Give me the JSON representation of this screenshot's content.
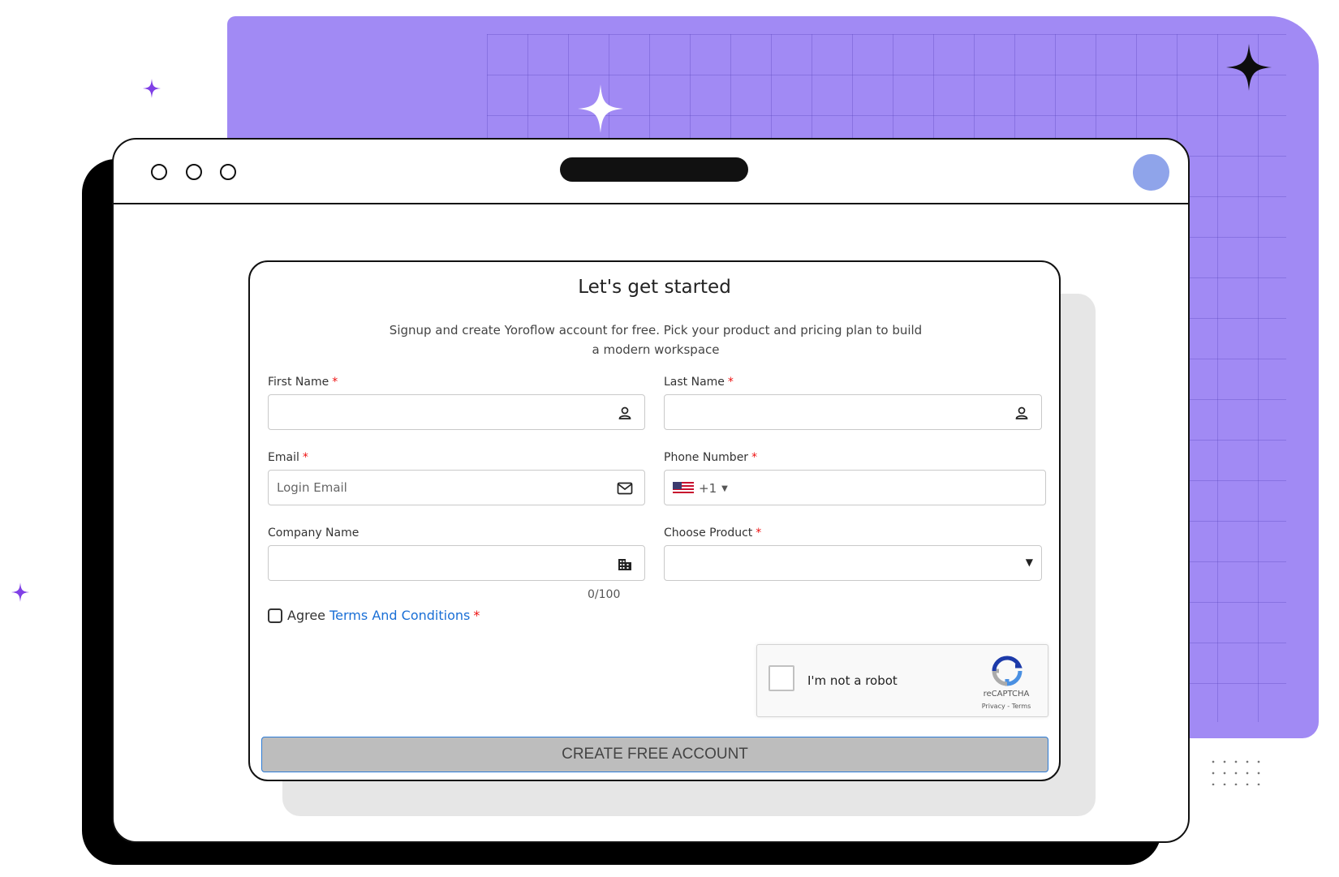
{
  "form": {
    "title": "Let's get started",
    "subtitle_line1": "Signup and create Yoroflow account for free. Pick your product and pricing plan to build",
    "subtitle_line2": "a modern workspace",
    "required_mark": "*",
    "first_name": {
      "label": "First Name",
      "value": "",
      "icon": "person-icon"
    },
    "last_name": {
      "label": "Last Name",
      "value": "",
      "icon": "person-icon"
    },
    "email": {
      "label": "Email",
      "placeholder": "Login Email",
      "icon": "mail-icon"
    },
    "phone": {
      "label": "Phone Number",
      "country_flag": "us-flag-icon",
      "dial_code": "+1",
      "value": ""
    },
    "company": {
      "label": "Company Name",
      "value": "",
      "icon": "building-icon",
      "counter": "0/100"
    },
    "product": {
      "label": "Choose Product",
      "selected": ""
    },
    "agree": {
      "prefix": "Agree",
      "link": "Terms And Conditions",
      "checked": false
    },
    "captcha": {
      "text": "I'm not a robot",
      "brand": "reCAPTCHA",
      "links": "Privacy - Terms"
    },
    "submit_label": "CREATE FREE ACCOUNT"
  },
  "colors": {
    "purple_background": "#a18af4",
    "avatar": "#8fa4ea",
    "link": "#1a6fd6",
    "required": "#e11111",
    "submit_bg": "#bdbdbd"
  }
}
